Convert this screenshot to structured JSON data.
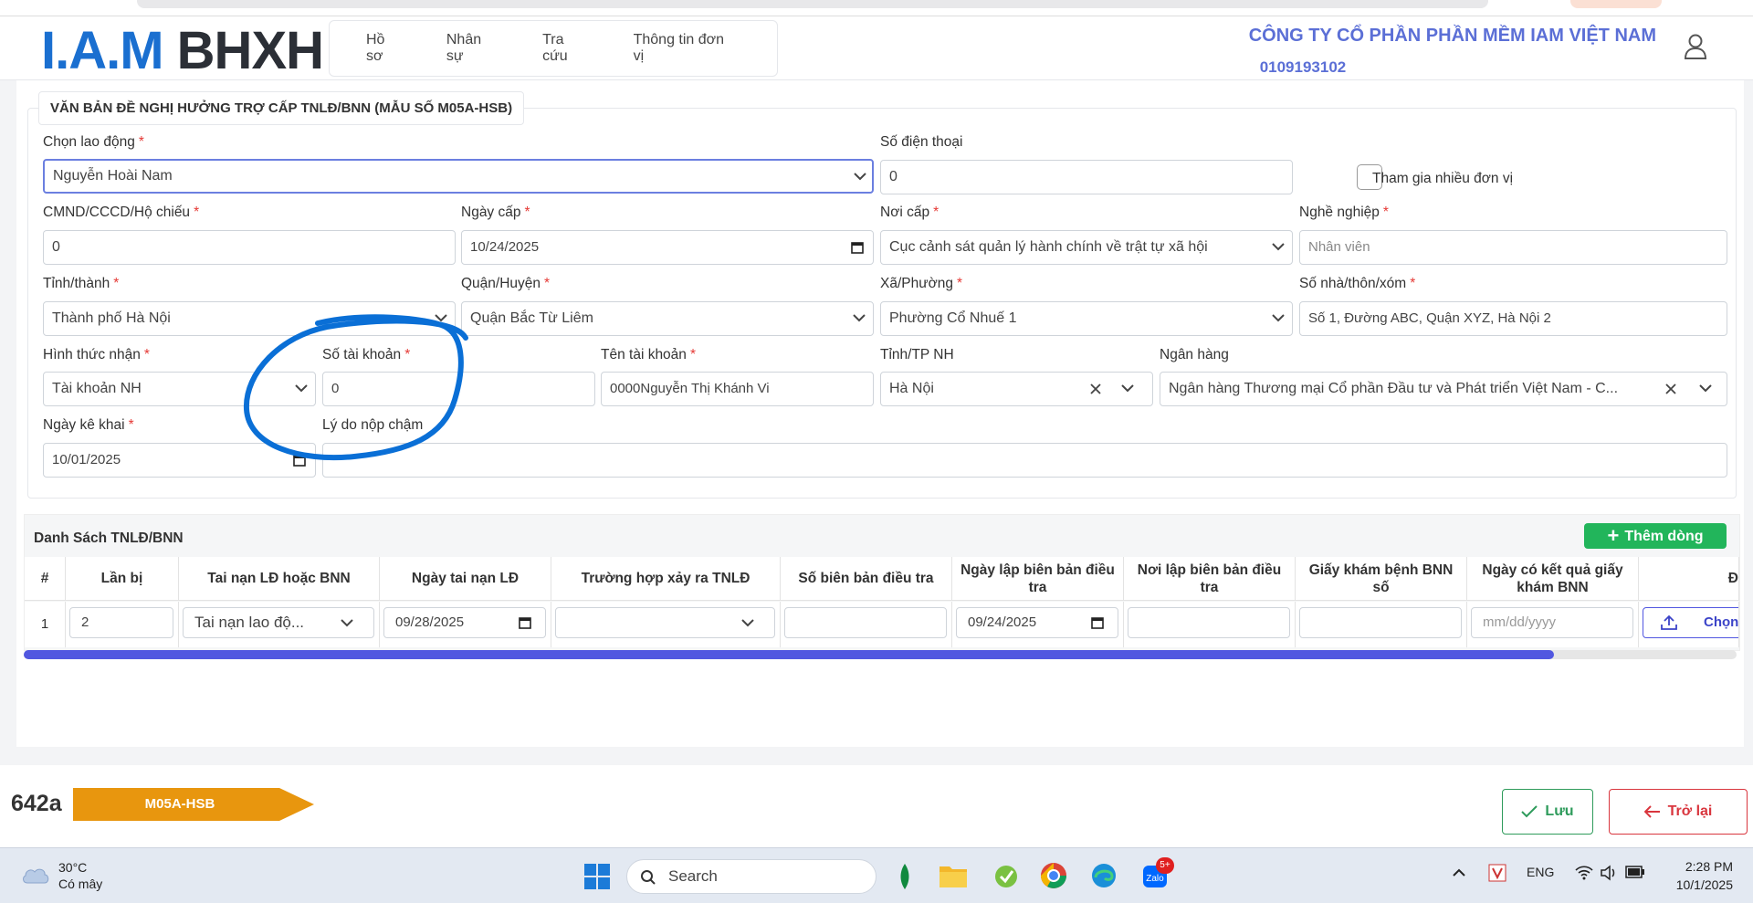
{
  "app": {
    "logo_iam": "I.A.M",
    "logo_bhxh": "BHXH",
    "nav": [
      "Hồ sơ",
      "Nhân sự",
      "Tra cứu",
      "Thông tin đơn vị"
    ],
    "company_name": "CÔNG TY CỔ PHẦN PHẦN MỀM IAM VIỆT NAM",
    "company_code": "0109193102"
  },
  "form": {
    "title": "VĂN BẢN ĐỀ NGHỊ HƯỞNG TRỢ CẤP TNLĐ/BNN (MẪU SỐ M05A-HSB)",
    "labels": {
      "employee": "Chọn lao động",
      "phone": "Số điện thoại",
      "multi_unit": "Tham gia nhiều đơn vị",
      "id_number": "CMND/CCCD/Hộ chiếu",
      "issue_date": "Ngày cấp",
      "issue_place": "Nơi cấp",
      "occupation": "Nghề nghiệp",
      "province": "Tỉnh/thành",
      "district": "Quận/Huyện",
      "ward": "Xã/Phường",
      "address": "Số nhà/thôn/xóm",
      "receive_method": "Hình thức nhận",
      "account_number": "Số tài khoản",
      "account_name": "Tên tài khoản",
      "bank_province": "Tỉnh/TP NH",
      "bank": "Ngân hàng",
      "declare_date": "Ngày kê khai",
      "late_reason": "Lý do nộp chậm"
    },
    "values": {
      "employee": "Nguyễn Hoài Nam",
      "phone": "0",
      "id_number": "0",
      "issue_date": "10/24/2025",
      "issue_place": "Cục cảnh sát quản lý hành chính về trật tự xã hội",
      "occupation": "Nhân viên",
      "province": "Thành phố Hà Nội",
      "district": "Quận Bắc Từ Liêm",
      "ward": "Phường Cổ Nhuế 1",
      "address": "Số 1, Đường ABC, Quận XYZ, Hà Nội 2",
      "receive_method": "Tài khoản NH",
      "account_number": "0",
      "account_name": "0000Nguyễn Thị Khánh Vi",
      "bank_province": "Hà Nội",
      "bank": "Ngân hàng Thương mại Cổ phần Đầu tư và Phát triển Việt Nam - C...",
      "declare_date": "10/01/2025",
      "late_reason": ""
    }
  },
  "table": {
    "title": "Danh Sách TNLĐ/BNN",
    "add_label": "Thêm dòng",
    "headers": [
      "#",
      "Lần bị",
      "Tai nạn LĐ hoặc BNN",
      "Ngày tai nạn LĐ",
      "Trường hợp xảy ra TNLĐ",
      "Số biên bản điều tra",
      "Ngày lập biên bản điều tra",
      "Nơi lập biên bản điều tra",
      "Giấy khám bệnh BNN số",
      "Ngày có kết quả giấy khám BNN",
      "Đ"
    ],
    "row": {
      "index": "1",
      "times": "2",
      "type": "Tai nạn lao độ...",
      "accident_date": "09/28/2025",
      "case": "",
      "report_no": "",
      "report_date": "09/24/2025",
      "report_place": "",
      "bnn_no": "",
      "result_date_placeholder": "mm/dd/yyyy",
      "upload_label": "Chọn"
    }
  },
  "footer": {
    "code": "642a",
    "form_tag": "M05A-HSB",
    "save_label": "Lưu",
    "back_label": "Trở lại"
  },
  "taskbar": {
    "temp": "30°C",
    "weather": "Có mây",
    "search": "Search",
    "badge": "5+",
    "lang": "ENG",
    "time": "2:28 PM",
    "date": "10/1/2025"
  },
  "colors": {
    "brand_blue": "#1a6fd0",
    "company_text": "#5b6fd6",
    "focus_border": "#6b7fe0",
    "required": "#e53935",
    "add_button": "#22b55b",
    "scroll_thumb": "#5157e0",
    "form_tag": "#e8960e",
    "save": "#2e9b5b",
    "back": "#d9363e",
    "annotation": "#0a6fd6"
  }
}
